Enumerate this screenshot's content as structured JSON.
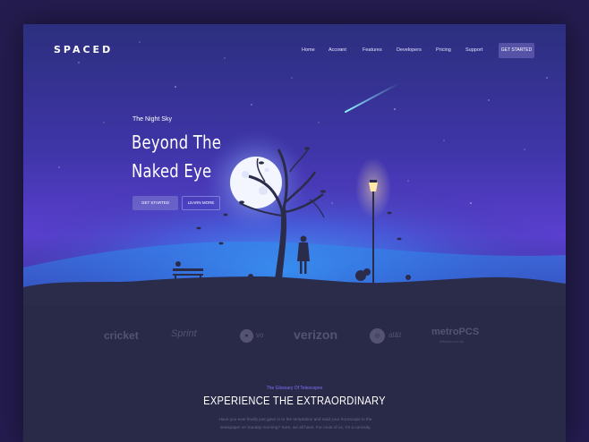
{
  "brand": {
    "logo": "SPACED"
  },
  "nav": {
    "items": [
      {
        "label": "Home"
      },
      {
        "label": "Account"
      },
      {
        "label": "Features"
      },
      {
        "label": "Developers"
      },
      {
        "label": "Pricing"
      },
      {
        "label": "Support"
      }
    ],
    "cta_label": "GET STARTED"
  },
  "hero": {
    "eyebrow": "The Night Sky",
    "headline_line1": "Beyond The",
    "headline_line2": "Naked Eye",
    "primary_button": "GET STARTED",
    "secondary_button": "LEARN MORE"
  },
  "partners": {
    "logos": [
      {
        "name": "cricket",
        "icon": "cricket-logo"
      },
      {
        "name": "Sprint",
        "icon": "sprint-logo"
      },
      {
        "name": "vo",
        "icon": "vo-logo"
      },
      {
        "name": "verizon",
        "icon": "verizon-logo"
      },
      {
        "name": "at&t",
        "icon": "att-logo"
      },
      {
        "name": "metroPCS",
        "tagline": "Wireless for All.",
        "icon": "metropcs-logo"
      }
    ]
  },
  "feature_section": {
    "eyebrow": "The Glossary Of Telescopes",
    "title": "EXPERIENCE THE EXTRAORDINARY",
    "body": "Have you ever finally just gave in to the temptation and read your horoscope in the newspaper on Sunday morning? Sure, we all have. For most of us, it's a curiosity."
  },
  "colors": {
    "sky_top": "#33368f",
    "sky_mid": "#5a3fd0",
    "glow": "#3f8ff0",
    "ground": "#2b2b4a",
    "accent": "#7f73ff"
  }
}
